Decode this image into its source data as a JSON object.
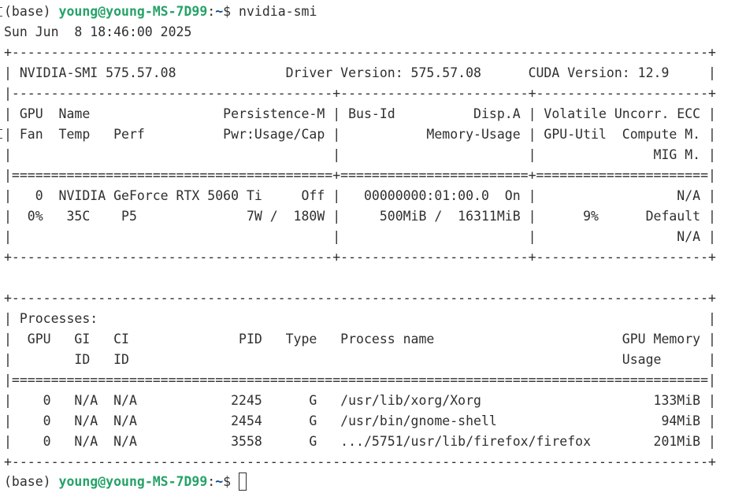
{
  "prompt": {
    "env": "(base) ",
    "user_host": "young@young-MS-7D99",
    "sep": ":",
    "path": "~",
    "symbol": "$ "
  },
  "command": "nvidia-smi",
  "output_lines": [
    "Sun Jun  8 18:46:00 2025",
    "+-----------------------------------------------------------------------------------------+",
    "| NVIDIA-SMI 575.57.08              Driver Version: 575.57.08      CUDA Version: 12.9     |",
    "|-----------------------------------------+------------------------+----------------------+",
    "| GPU  Name                 Persistence-M | Bus-Id          Disp.A | Volatile Uncorr. ECC |",
    "| Fan  Temp   Perf          Pwr:Usage/Cap |           Memory-Usage | GPU-Util  Compute M. |",
    "|                                         |                        |               MIG M. |",
    "|=========================================+========================+======================|",
    "|   0  NVIDIA GeForce RTX 5060 Ti     Off |   00000000:01:00.0  On |                  N/A |",
    "|  0%   35C    P5              7W /  180W |     500MiB /  16311MiB |      9%      Default |",
    "|                                         |                        |                  N/A |",
    "+-----------------------------------------+------------------------+----------------------+",
    "",
    "+-----------------------------------------------------------------------------------------+",
    "| Processes:                                                                              |",
    "|  GPU   GI   CI              PID   Type   Process name                        GPU Memory |",
    "|        ID   ID                                                               Usage      |",
    "|=========================================================================================|",
    "|    0   N/A  N/A            2245      G   /usr/lib/xorg/Xorg                      133MiB |",
    "|    0   N/A  N/A            2454      G   /usr/bin/gnome-shell                     94MiB |",
    "|    0   N/A  N/A            3558      G   .../5751/usr/lib/firefox/firefox        201MiB |",
    "+-----------------------------------------------------------------------------------------+"
  ],
  "colors": {
    "background": "#ffffff",
    "text": "#2f2f2f",
    "user_host": "#26a269",
    "path": "#12488b"
  }
}
